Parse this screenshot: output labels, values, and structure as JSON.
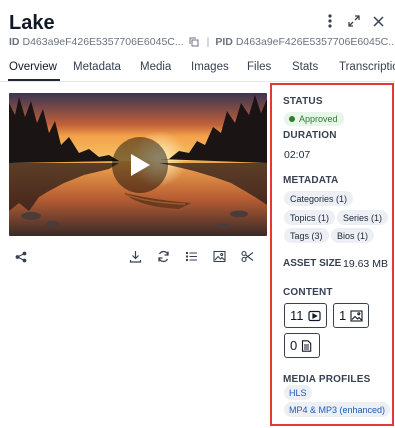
{
  "header": {
    "title": "Lake",
    "id_label": "ID",
    "id_value": "D463a9eF426E5357706E6045C...",
    "pid_label": "PID",
    "pid_value": "D463a9eF426E5357706E6045C..."
  },
  "tabs": [
    {
      "label": "Overview",
      "active": true
    },
    {
      "label": "Metadata"
    },
    {
      "label": "Media"
    },
    {
      "label": "Images"
    },
    {
      "label": "Files"
    },
    {
      "label": "Stats"
    },
    {
      "label": "Transcription"
    }
  ],
  "video": {
    "thumbnail_icon": "lake-canoe-sunset-thumbnail",
    "play_icon": "play-icon"
  },
  "actions": [
    "share-icon",
    "download-icon",
    "refresh-icon",
    "list-icon",
    "image-icon",
    "scissors-icon"
  ],
  "details": {
    "status_label": "STATUS",
    "status_value": "Approved",
    "status_color": "#2e7d32",
    "duration_label": "DURATION",
    "duration_value": "02:07",
    "metadata_label": "METADATA",
    "metadata_chips": [
      "Categories (1)",
      "Topics (1)",
      "Series (1)",
      "Tags (3)",
      "Bios (1)"
    ],
    "asset_size_label": "ASSET SIZE",
    "asset_size_value": "19.63 MB",
    "content_label": "CONTENT",
    "content_counts": [
      {
        "count": "11",
        "icon": "video-icon"
      },
      {
        "count": "1",
        "icon": "image-icon"
      },
      {
        "count": "0",
        "icon": "document-icon"
      }
    ],
    "media_profiles_label": "MEDIA PROFILES",
    "media_profiles": [
      "HLS",
      "MP4 & MP3 (enhanced)"
    ]
  },
  "colors": {
    "highlight_border": "#e53935",
    "link_blue": "#1e5bb8"
  }
}
